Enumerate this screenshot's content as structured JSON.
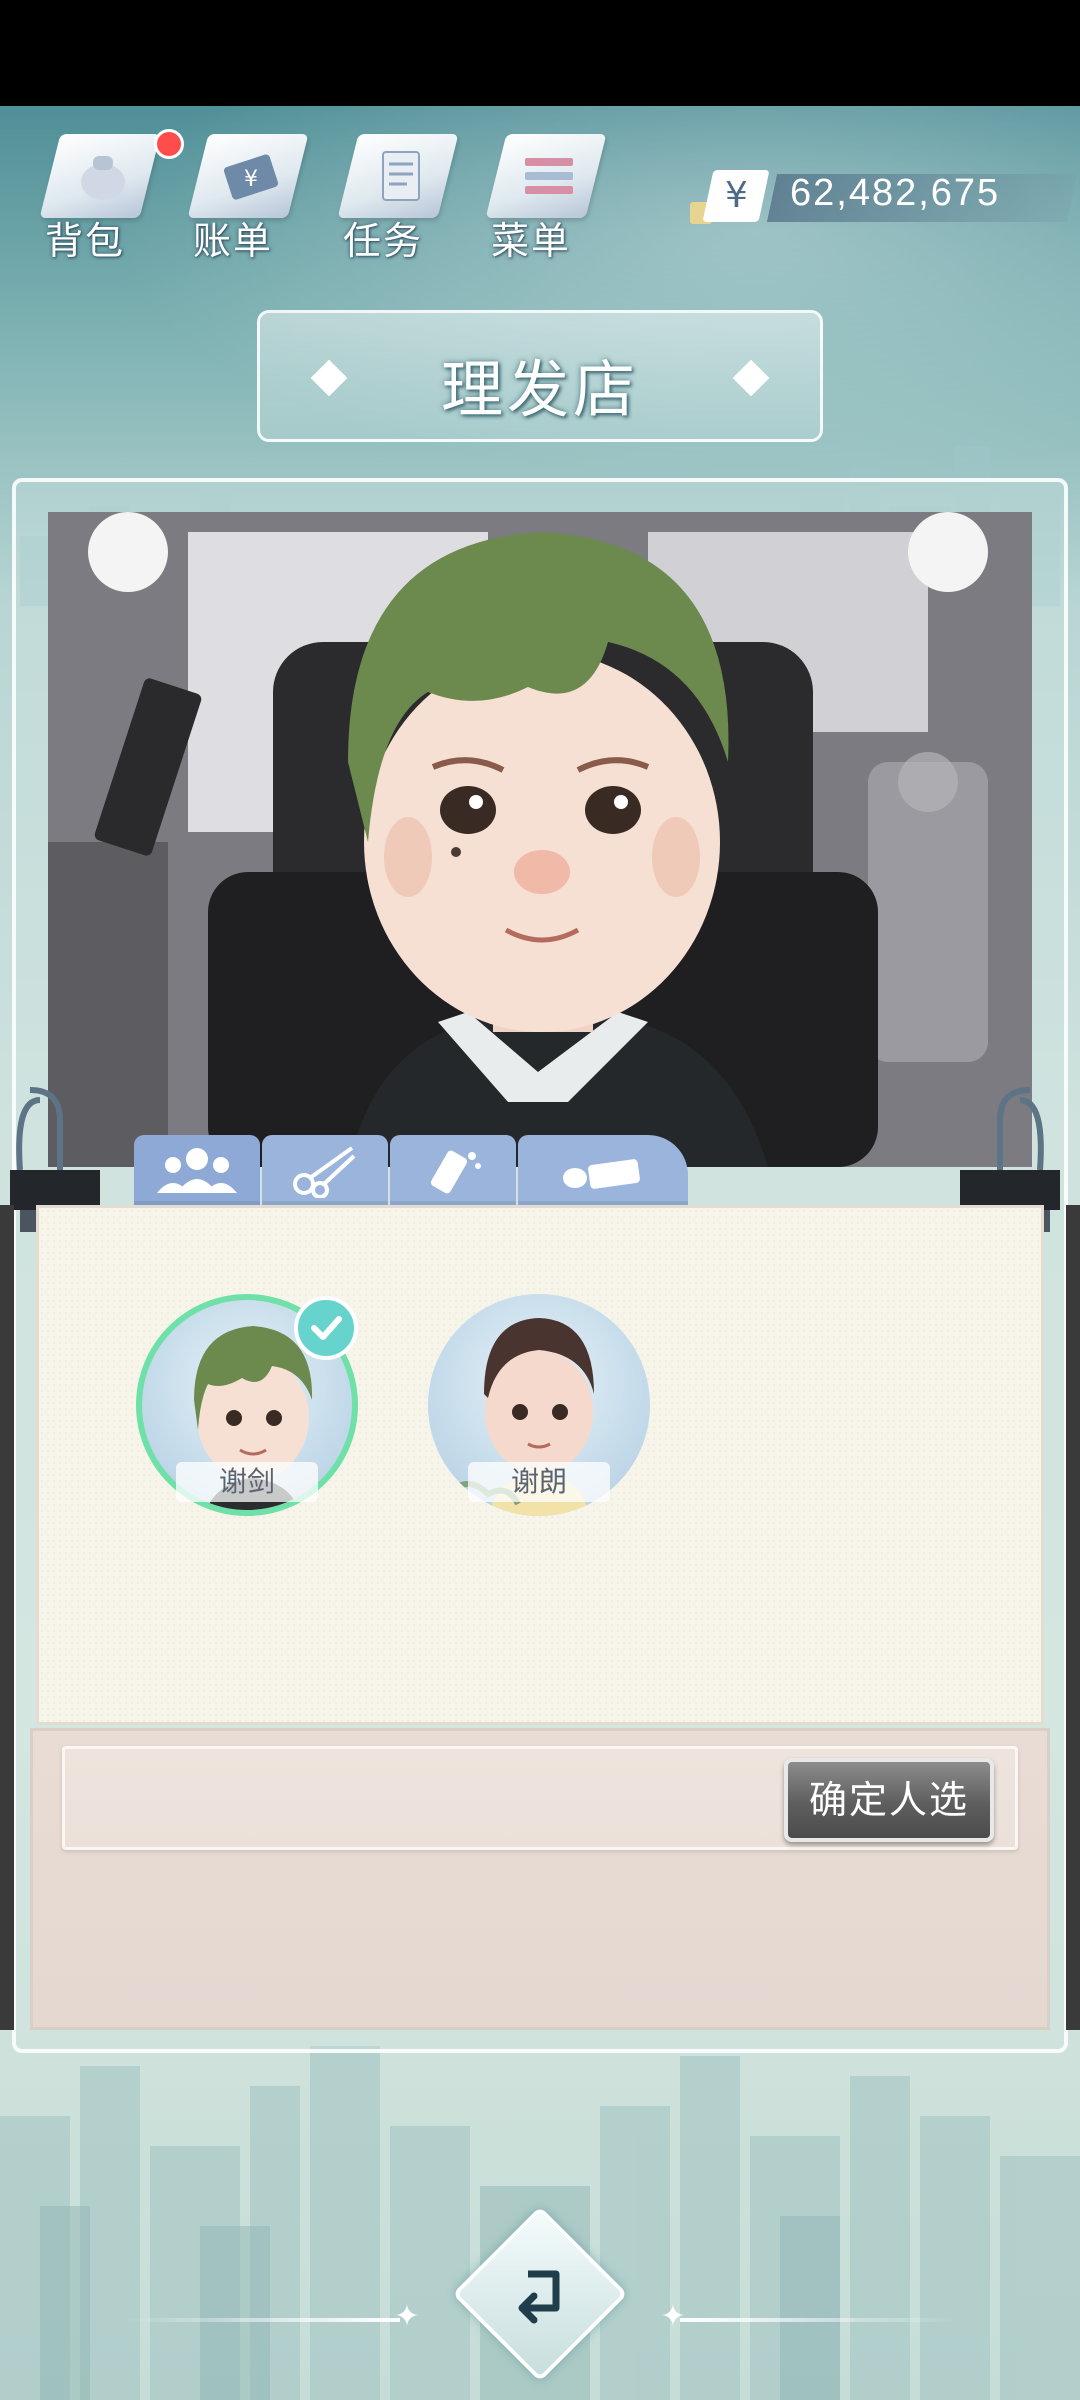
{
  "nav": {
    "items": [
      {
        "label": "背包",
        "icon": "backpack-icon"
      },
      {
        "label": "账单",
        "icon": "bill-icon"
      },
      {
        "label": "任务",
        "icon": "task-icon"
      },
      {
        "label": "菜单",
        "icon": "menu-icon"
      }
    ],
    "currency_symbol": "¥",
    "money": "62,482,675"
  },
  "title": "理发店",
  "tabs": [
    {
      "icon": "people-icon",
      "active": true
    },
    {
      "icon": "scissors-icon",
      "active": false
    },
    {
      "icon": "hair-dye-icon",
      "active": false
    },
    {
      "icon": "eraser-icon",
      "active": false
    }
  ],
  "candidates": [
    {
      "name": "谢剑",
      "selected": true
    },
    {
      "name": "谢朗",
      "selected": false
    }
  ],
  "confirm_label": "确定人选",
  "colors": {
    "accent": "#66d3cc",
    "tab": "#9bb4dc",
    "selected_ring": "#6fe0a8",
    "hair": "#6c8a4e"
  }
}
